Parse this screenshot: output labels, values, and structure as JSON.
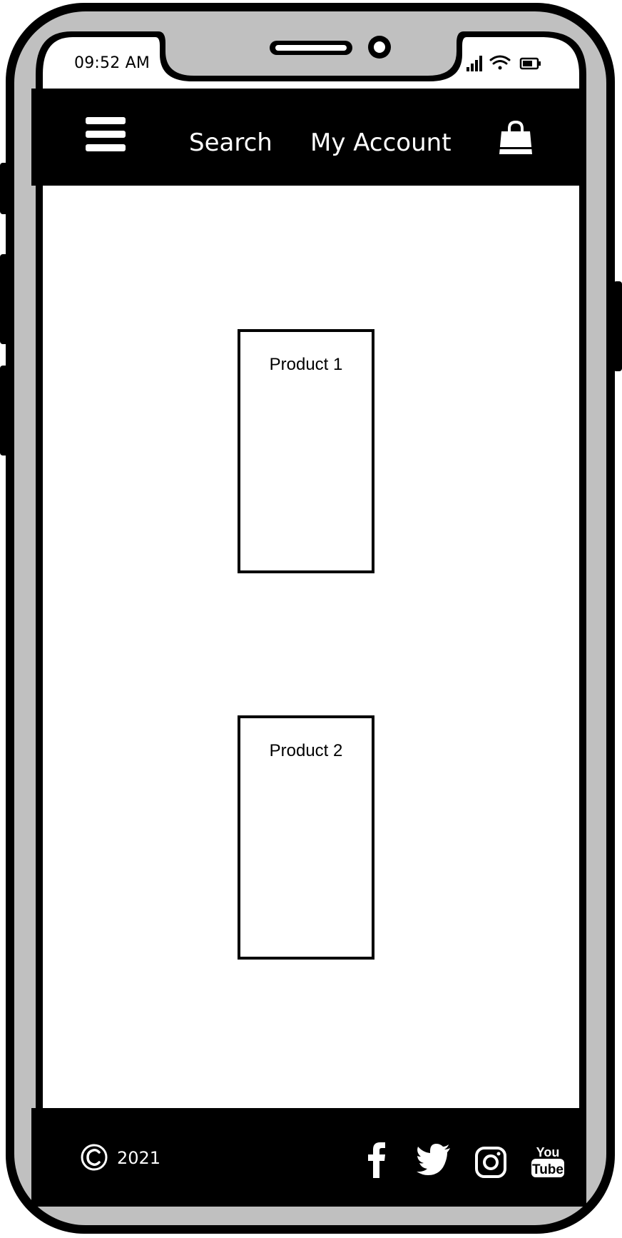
{
  "status_bar": {
    "time": "09:52 AM",
    "icons": [
      "signal-icon",
      "wifi-icon",
      "battery-icon"
    ]
  },
  "navbar": {
    "menu_icon": "menu-icon",
    "search_label": "Search",
    "account_label": "My Account",
    "cart_icon": "shopping-bag-icon"
  },
  "products": [
    {
      "label": "Product 1"
    },
    {
      "label": "Product 2"
    }
  ],
  "footer": {
    "copyright_icon": "copyright-icon",
    "year": "2021",
    "social_icons": [
      "facebook-icon",
      "twitter-icon",
      "instagram-icon",
      "youtube-icon"
    ],
    "youtube_text_top": "You",
    "youtube_text_bottom": "Tube"
  },
  "colors": {
    "frame": "#000000",
    "bezel": "#c0c0c0",
    "screen": "#ffffff",
    "bars": "#000000"
  }
}
